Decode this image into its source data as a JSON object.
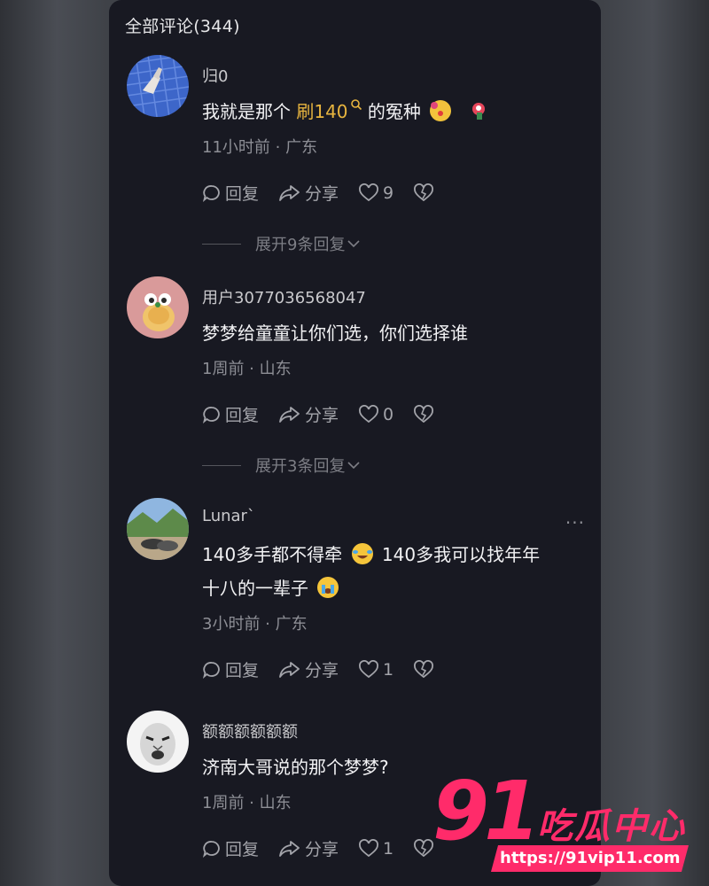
{
  "header": {
    "title": "全部评论(344)"
  },
  "comments": [
    {
      "username": "归0",
      "content_before": "我就是那个 ",
      "content_highlight": "刷140",
      "content_after": " 的冤种",
      "meta": "11小时前 · 广东",
      "reply_label": "回复",
      "share_label": "分享",
      "likes": "9",
      "expand_label": "展开9条回复"
    },
    {
      "username": "用户3077036568047",
      "content": "梦梦给童童让你们选，你们选择谁",
      "meta": "1周前 · 山东",
      "reply_label": "回复",
      "share_label": "分享",
      "likes": "0",
      "expand_label": "展开3条回复"
    },
    {
      "username": "Lunar`",
      "content_line1_a": "140多手都不得牵",
      "content_line1_b": " 140多我可以找年年",
      "content_line2": "十八的一辈子",
      "meta": "3小时前 · 广东",
      "reply_label": "回复",
      "share_label": "分享",
      "likes": "1",
      "more": "···"
    },
    {
      "username": "额额额额额额",
      "content": "济南大哥说的那个梦梦?",
      "meta": "1周前 · 山东",
      "reply_label": "回复",
      "share_label": "分享",
      "likes": "1"
    }
  ],
  "watermark": {
    "number": "91",
    "brand": "吃瓜中心",
    "url": "https://91vip11.com"
  },
  "colors": {
    "panel_bg": "#181922",
    "highlight": "#e8b53f",
    "watermark": "#ff2b6a"
  }
}
